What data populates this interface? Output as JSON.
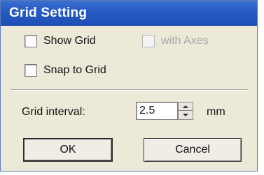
{
  "dialog": {
    "title": "Grid Setting",
    "show_grid": {
      "label": "Show Grid",
      "checked": false
    },
    "with_axes": {
      "label": "with Axes",
      "checked": false,
      "enabled": false
    },
    "snap_to_grid": {
      "label": "Snap to Grid",
      "checked": false
    },
    "grid_interval": {
      "label": "Grid interval:",
      "value": "2.5",
      "unit": "mm"
    },
    "ok_label": "OK",
    "cancel_label": "Cancel"
  },
  "colors": {
    "titlebar": "#2659c4",
    "dialog_background": "#ece9d8",
    "disabled_text": "#a8a8a8"
  }
}
